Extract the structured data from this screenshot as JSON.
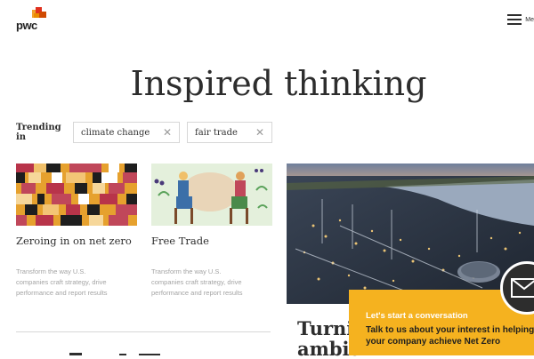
{
  "header": {
    "logo_text": "pwc",
    "menu_label": "Me"
  },
  "hero": {
    "title": "Inspired thinking"
  },
  "trending": {
    "label": "Trending in",
    "chips": [
      {
        "label": "climate change",
        "remove_icon": "close-icon"
      },
      {
        "label": "fair trade",
        "remove_icon": "close-icon"
      }
    ]
  },
  "cards": [
    {
      "title": "Zeroing in on net zero",
      "description": [
        "Transform the way U.S.",
        "companies craft strategy, drive",
        "performance and report results"
      ]
    },
    {
      "title": "Free Trade",
      "description": [
        "Transform the way U.S.",
        "companies craft strategy, drive",
        "performance and report results"
      ]
    }
  ],
  "feature": {
    "title_lines": [
      "Turnin",
      "ambiti"
    ]
  },
  "cta": {
    "heading": "Let's start a conversation",
    "body_lines": [
      "Talk to us about your interest in helping",
      "your company achieve Net Zero"
    ],
    "icon": "envelope-icon"
  },
  "colors": {
    "brand_orange": "#f5b21f",
    "text": "#2d2d2d",
    "muted": "#a4a4a4"
  }
}
